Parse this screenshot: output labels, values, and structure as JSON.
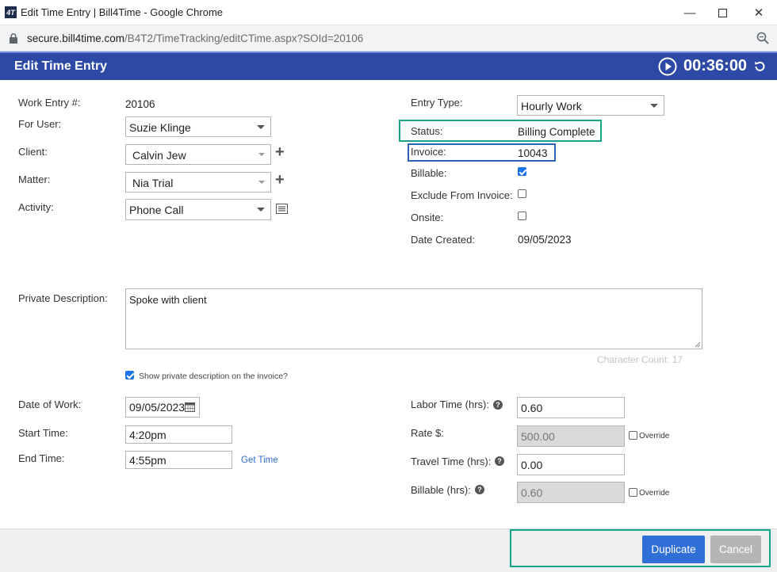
{
  "window": {
    "title": "Edit Time Entry | Bill4Time - Google Chrome",
    "logo_text": "4T",
    "url_host": "secure.bill4time.com",
    "url_path": "/B4T2/TimeTracking/editCTime.aspx?SOId=20106"
  },
  "header": {
    "title": "Edit Time Entry",
    "timer": "00:36:00"
  },
  "left": {
    "work_entry_label": "Work Entry #:",
    "work_entry_value": "20106",
    "for_user_label": "For User:",
    "for_user_value": "Suzie Klinge",
    "client_label": "Client:",
    "client_value": "Calvin Jew",
    "matter_label": "Matter:",
    "matter_value": "Nia Trial",
    "activity_label": "Activity:",
    "activity_value": "Phone Call"
  },
  "right": {
    "entry_type_label": "Entry Type:",
    "entry_type_value": "Hourly Work",
    "status_label": "Status:",
    "status_value": "Billing Complete",
    "invoice_label": "Invoice:",
    "invoice_value": "10043",
    "billable_label": "Billable:",
    "billable_checked": true,
    "exclude_label": "Exclude From Invoice:",
    "exclude_checked": false,
    "onsite_label": "Onsite:",
    "onsite_checked": false,
    "date_created_label": "Date Created:",
    "date_created_value": "09/05/2023"
  },
  "description": {
    "label": "Private Description:",
    "value": "Spoke with client",
    "char_count": "Character Count: 17",
    "show_on_invoice_label": "Show private description on the invoice?",
    "show_on_invoice_checked": true
  },
  "time": {
    "date_of_work_label": "Date of Work:",
    "date_of_work_value": "09/05/2023",
    "start_label": "Start Time:",
    "start_value": "4:20pm",
    "end_label": "End Time:",
    "end_value": "4:55pm",
    "get_time_label": "Get Time",
    "labor_label": "Labor Time (hrs):",
    "labor_value": "0.60",
    "rate_label": "Rate $:",
    "rate_value": "500.00",
    "travel_label": "Travel Time (hrs):",
    "travel_value": "0.00",
    "billable_hrs_label": "Billable (hrs):",
    "billable_hrs_value": "0.60",
    "override_label": "Override"
  },
  "footer": {
    "duplicate_label": "Duplicate",
    "cancel_label": "Cancel"
  },
  "colors": {
    "header_bg": "#2c4aa5",
    "highlight_green": "#17a589",
    "highlight_blue": "#2e64b8",
    "primary_button": "#2f6fd6",
    "disabled_button": "#b5b5b5"
  }
}
